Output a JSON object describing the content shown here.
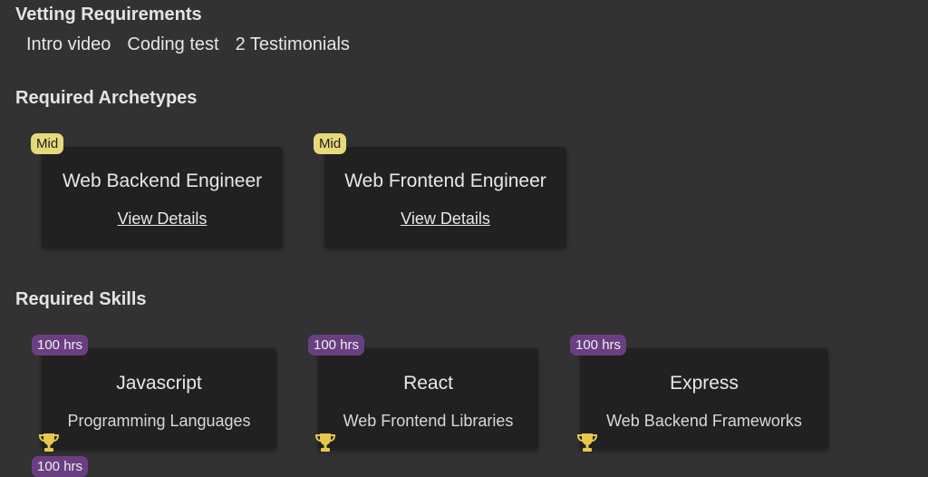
{
  "vetting": {
    "title": "Vetting Requirements",
    "items": [
      "Intro video",
      "Coding test",
      "2 Testimonials"
    ]
  },
  "archetypes": {
    "title": "Required Archetypes",
    "cards": [
      {
        "level": "Mid",
        "name": "Web Backend Engineer",
        "link": "View Details"
      },
      {
        "level": "Mid",
        "name": "Web Frontend Engineer",
        "link": "View Details"
      }
    ]
  },
  "skills": {
    "title": "Required Skills",
    "cards": [
      {
        "hours": "100 hrs",
        "name": "Javascript",
        "category": "Programming Languages",
        "icon": "trophy-icon"
      },
      {
        "hours": "100 hrs",
        "name": "React",
        "category": "Web Frontend Libraries",
        "icon": "trophy-icon"
      },
      {
        "hours": "100 hrs",
        "name": "Express",
        "category": "Web Backend Frameworks",
        "icon": "trophy-icon"
      }
    ],
    "next_hours": "100 hrs"
  },
  "colors": {
    "background": "#323232",
    "card": "#212121",
    "level_badge": "#e6d97a",
    "hours_badge": "#6a3f82",
    "trophy": "#e8c84a"
  }
}
